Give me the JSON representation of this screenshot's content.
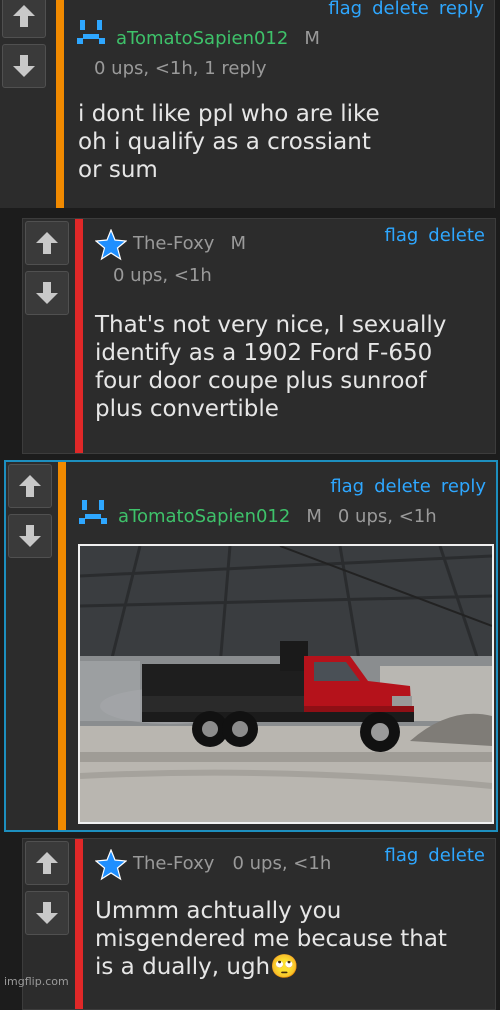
{
  "comments": [
    {
      "username": "aTomatoSapien012",
      "badge": "M",
      "meta": "0 ups, <1h, 1 reply",
      "actions": [
        "flag",
        "delete",
        "reply"
      ],
      "lines": [
        "i dont like ppl who are like",
        "oh i qualify as a crossiant",
        "or sum"
      ]
    },
    {
      "username": "The-Foxy",
      "badge": "M",
      "meta": "0 ups, <1h",
      "actions": [
        "flag",
        "delete"
      ],
      "lines": [
        "That's not very nice, I sexually",
        "identify as a 1902 Ford F-650",
        "four door coupe plus sunroof",
        "plus convertible"
      ]
    },
    {
      "username": "aTomatoSapien012",
      "badge": "M",
      "meta": "0 ups, <1h",
      "actions": [
        "flag",
        "delete",
        "reply"
      ],
      "image": "red-dump-truck-photo"
    },
    {
      "username": "The-Foxy",
      "meta": "0 ups, <1h",
      "actions": [
        "flag",
        "delete"
      ],
      "lines": [
        "Ummm achtually you",
        "misgendered me because that",
        "is a dually, ugh🙄"
      ]
    }
  ],
  "watermark": "imgflip.com",
  "colors": {
    "link": "#2ea7ff",
    "green_user": "#3ec26a",
    "orange_bar": "#f18a00",
    "red_bar": "#e02828",
    "highlight_border": "#1d8fbf"
  }
}
